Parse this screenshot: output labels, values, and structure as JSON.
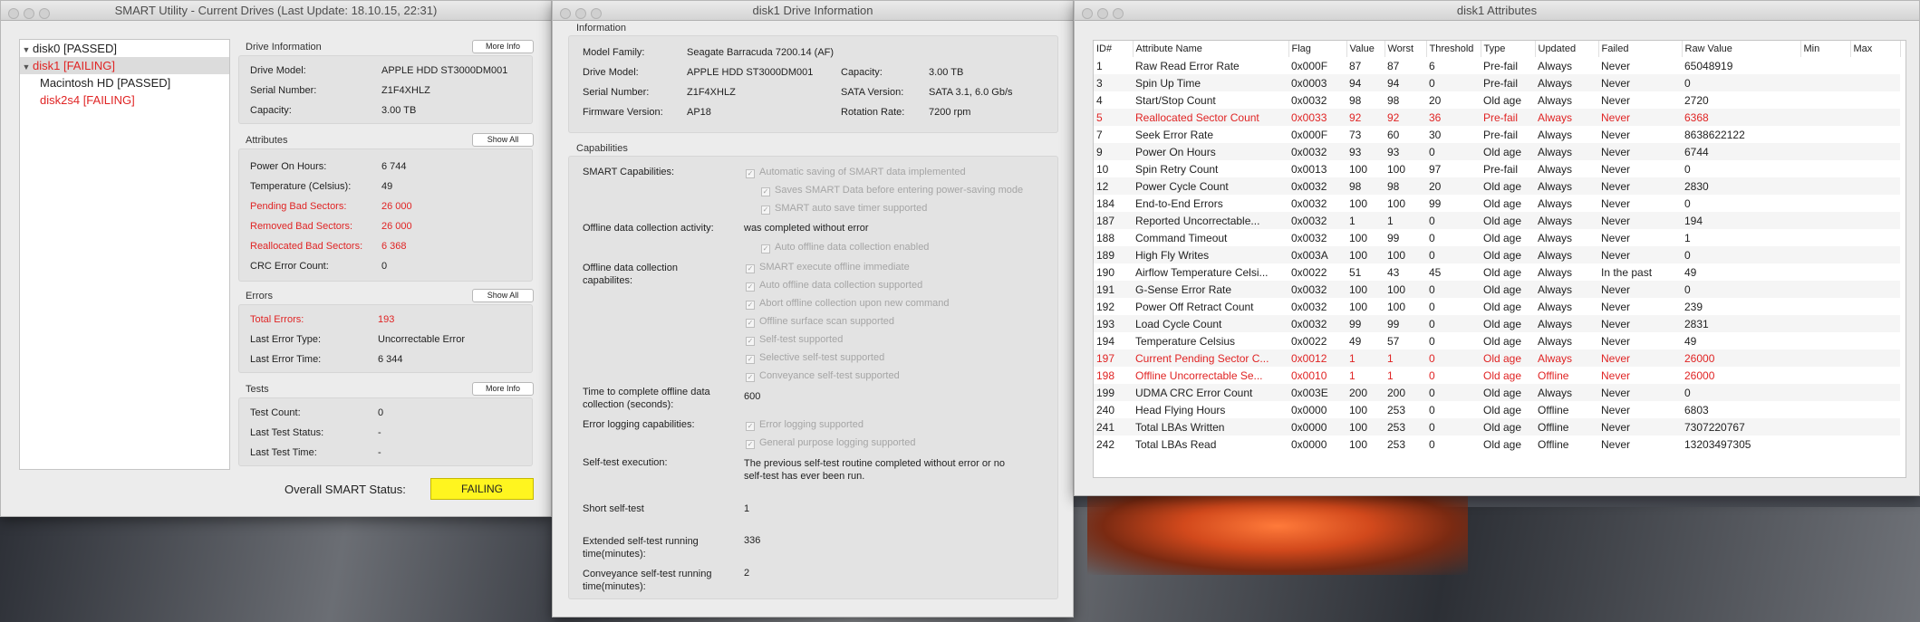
{
  "windows": {
    "utility": {
      "title": "SMART Utility - Current Drives (Last Update: 18.10.15, 22:31)",
      "drives": [
        {
          "label": "disk0  [PASSED]",
          "failing": false,
          "expandable": true
        },
        {
          "label": "disk1  [FAILING]",
          "failing": true,
          "expandable": true,
          "selected": true
        },
        {
          "label": "Macintosh HD  [PASSED]",
          "failing": false,
          "expandable": false
        },
        {
          "label": "disk2s4  [FAILING]",
          "failing": true,
          "expandable": false
        }
      ],
      "drive_info": {
        "heading": "Drive Information",
        "button": "More Info",
        "model_label": "Drive Model:",
        "model": "APPLE HDD ST3000DM001",
        "serial_label": "Serial Number:",
        "serial": "Z1F4XHLZ",
        "capacity_label": "Capacity:",
        "capacity": "3.00 TB"
      },
      "attributes": {
        "heading": "Attributes",
        "button": "Show All",
        "power_label": "Power On Hours:",
        "power": "6 744",
        "temp_label": "Temperature (Celsius):",
        "temp": "49",
        "pending_label": "Pending Bad Sectors:",
        "pending": "26 000",
        "removed_label": "Removed Bad Sectors:",
        "removed": "26 000",
        "realloc_label": "Reallocated Bad Sectors:",
        "realloc": "6 368",
        "crc_label": "CRC Error Count:",
        "crc": "0"
      },
      "errors": {
        "heading": "Errors",
        "button": "Show All",
        "total_label": "Total Errors:",
        "total": "193",
        "type_label": "Last Error Type:",
        "type": "Uncorrectable Error",
        "time_label": "Last Error Time:",
        "time": "6 344"
      },
      "tests": {
        "heading": "Tests",
        "button": "More Info",
        "count_label": "Test Count:",
        "count": "0",
        "status_label": "Last Test Status:",
        "status": "-",
        "time_label": "Last Test Time:",
        "time": "-"
      },
      "overall_label": "Overall SMART Status:",
      "overall": "FAILING"
    },
    "info": {
      "title": "disk1 Drive Information",
      "information": {
        "heading": "Information",
        "family_label": "Model Family:",
        "family": "Seagate Barracuda 7200.14 (AF)",
        "model_label": "Drive Model:",
        "model": "APPLE HDD ST3000DM001",
        "serial_label": "Serial Number:",
        "serial": "Z1F4XHLZ",
        "firmware_label": "Firmware Version:",
        "firmware": "AP18",
        "capacity_label": "Capacity:",
        "capacity": "3.00 TB",
        "sata_label": "SATA Version:",
        "sata": "SATA 3.1, 6.0 Gb/s",
        "rotation_label": "Rotation Rate:",
        "rotation": "7200 rpm"
      },
      "capabilities": {
        "heading": "Capabilities",
        "smart_label": "SMART Capabilities:",
        "smart_items": [
          "Automatic saving of SMART data implemented",
          "Saves SMART Data before entering power-saving mode",
          "SMART auto save timer supported"
        ],
        "offline_activity_label": "Offline data collection activity:",
        "offline_activity": "was completed without error",
        "offline_activity_item": "Auto offline data collection enabled",
        "offline_cap_label": "Offline data collection capabilites:",
        "offline_cap_items": [
          "SMART execute offline immediate",
          "Auto offline data collection supported",
          "Abort offline collection upon new command",
          "Offline surface scan supported",
          "Self-test supported",
          "Selective self-test supported",
          "Conveyance self-test supported"
        ],
        "time_offline_label": "Time to complete offline data collection (seconds):",
        "time_offline": "600",
        "error_log_label": "Error logging capabilities:",
        "error_log_items": [
          "Error logging supported",
          "General purpose logging supported"
        ],
        "selftest_exec_label": "Self-test execution:",
        "selftest_exec": "The previous self-test routine completed without error or no self-test has ever been run.",
        "short_label": "Short self-test",
        "short": "1",
        "extended_label": "Extended self-test running time(minutes):",
        "extended": "336",
        "conveyance_label": "Conveyance self-test running time(minutes):",
        "conveyance": "2"
      }
    },
    "attrs": {
      "title": "disk1 Attributes",
      "columns": [
        "ID#",
        "Attribute Name",
        "Flag",
        "Value",
        "Worst",
        "Threshold",
        "Type",
        "Updated",
        "Failed",
        "Raw Value",
        "Min",
        "Max"
      ],
      "rows": [
        {
          "c": [
            "1",
            "Raw Read Error Rate",
            "0x000F",
            "87",
            "87",
            "6",
            "Pre-fail",
            "Always",
            "Never",
            "65048919",
            "",
            ""
          ],
          "hl": false
        },
        {
          "c": [
            "3",
            "Spin Up Time",
            "0x0003",
            "94",
            "94",
            "0",
            "Pre-fail",
            "Always",
            "Never",
            "0",
            "",
            ""
          ],
          "hl": false
        },
        {
          "c": [
            "4",
            "Start/Stop Count",
            "0x0032",
            "98",
            "98",
            "20",
            "Old age",
            "Always",
            "Never",
            "2720",
            "",
            ""
          ],
          "hl": false
        },
        {
          "c": [
            "5",
            "Reallocated Sector Count",
            "0x0033",
            "92",
            "92",
            "36",
            "Pre-fail",
            "Always",
            "Never",
            "6368",
            "",
            ""
          ],
          "hl": true
        },
        {
          "c": [
            "7",
            "Seek Error Rate",
            "0x000F",
            "73",
            "60",
            "30",
            "Pre-fail",
            "Always",
            "Never",
            "8638622122",
            "",
            ""
          ],
          "hl": false
        },
        {
          "c": [
            "9",
            "Power On Hours",
            "0x0032",
            "93",
            "93",
            "0",
            "Old age",
            "Always",
            "Never",
            "6744",
            "",
            ""
          ],
          "hl": false
        },
        {
          "c": [
            "10",
            "Spin Retry Count",
            "0x0013",
            "100",
            "100",
            "97",
            "Pre-fail",
            "Always",
            "Never",
            "0",
            "",
            ""
          ],
          "hl": false
        },
        {
          "c": [
            "12",
            "Power Cycle Count",
            "0x0032",
            "98",
            "98",
            "20",
            "Old age",
            "Always",
            "Never",
            "2830",
            "",
            ""
          ],
          "hl": false
        },
        {
          "c": [
            "184",
            "End-to-End Errors",
            "0x0032",
            "100",
            "100",
            "99",
            "Old age",
            "Always",
            "Never",
            "0",
            "",
            ""
          ],
          "hl": false
        },
        {
          "c": [
            "187",
            "Reported Uncorrectable...",
            "0x0032",
            "1",
            "1",
            "0",
            "Old age",
            "Always",
            "Never",
            "194",
            "",
            ""
          ],
          "hl": false
        },
        {
          "c": [
            "188",
            "Command Timeout",
            "0x0032",
            "100",
            "99",
            "0",
            "Old age",
            "Always",
            "Never",
            "1",
            "",
            ""
          ],
          "hl": false
        },
        {
          "c": [
            "189",
            "High Fly Writes",
            "0x003A",
            "100",
            "100",
            "0",
            "Old age",
            "Always",
            "Never",
            "0",
            "",
            ""
          ],
          "hl": false
        },
        {
          "c": [
            "190",
            "Airflow Temperature Celsi...",
            "0x0022",
            "51",
            "43",
            "45",
            "Old age",
            "Always",
            "In the past",
            "49",
            "",
            ""
          ],
          "hl": false
        },
        {
          "c": [
            "191",
            "G-Sense Error Rate",
            "0x0032",
            "100",
            "100",
            "0",
            "Old age",
            "Always",
            "Never",
            "0",
            "",
            ""
          ],
          "hl": false
        },
        {
          "c": [
            "192",
            "Power Off Retract Count",
            "0x0032",
            "100",
            "100",
            "0",
            "Old age",
            "Always",
            "Never",
            "239",
            "",
            ""
          ],
          "hl": false
        },
        {
          "c": [
            "193",
            "Load Cycle Count",
            "0x0032",
            "99",
            "99",
            "0",
            "Old age",
            "Always",
            "Never",
            "2831",
            "",
            ""
          ],
          "hl": false
        },
        {
          "c": [
            "194",
            "Temperature Celsius",
            "0x0022",
            "49",
            "57",
            "0",
            "Old age",
            "Always",
            "Never",
            "49",
            "",
            ""
          ],
          "hl": false
        },
        {
          "c": [
            "197",
            "Current Pending Sector C...",
            "0x0012",
            "1",
            "1",
            "0",
            "Old age",
            "Always",
            "Never",
            "26000",
            "",
            ""
          ],
          "hl": true
        },
        {
          "c": [
            "198",
            "Offline Uncorrectable Se...",
            "0x0010",
            "1",
            "1",
            "0",
            "Old age",
            "Offline",
            "Never",
            "26000",
            "",
            ""
          ],
          "hl": true
        },
        {
          "c": [
            "199",
            "UDMA CRC Error Count",
            "0x003E",
            "200",
            "200",
            "0",
            "Old age",
            "Always",
            "Never",
            "0",
            "",
            ""
          ],
          "hl": false
        },
        {
          "c": [
            "240",
            "Head Flying Hours",
            "0x0000",
            "100",
            "253",
            "0",
            "Old age",
            "Offline",
            "Never",
            "6803",
            "",
            ""
          ],
          "hl": false
        },
        {
          "c": [
            "241",
            "Total LBAs Written",
            "0x0000",
            "100",
            "253",
            "0",
            "Old age",
            "Offline",
            "Never",
            "7307220767",
            "",
            ""
          ],
          "hl": false
        },
        {
          "c": [
            "242",
            "Total LBAs Read",
            "0x0000",
            "100",
            "253",
            "0",
            "Old age",
            "Offline",
            "Never",
            "13203497305",
            "",
            ""
          ],
          "hl": false
        }
      ]
    }
  },
  "colors": {
    "failing": "#e02424",
    "status_fail_bg": "#fff51f"
  }
}
